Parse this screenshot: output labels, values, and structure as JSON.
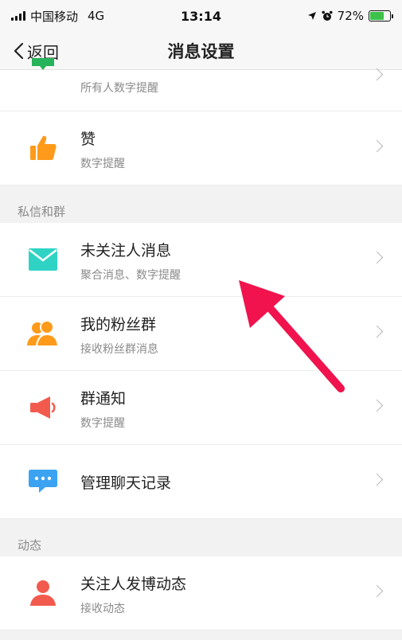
{
  "status_bar": {
    "carrier": "中国移动",
    "network": "4G",
    "time": "13:14",
    "battery_percent": "72%",
    "battery_level": 0.72
  },
  "nav": {
    "back_label": "返回",
    "title": "消息设置"
  },
  "top_partial_item": {
    "subtitle": "所有人数字提醒",
    "icon": "message-icon"
  },
  "like_item": {
    "title": "赞",
    "subtitle": "数字提醒",
    "icon": "thumbs-up-icon"
  },
  "section_private": {
    "title": "私信和群",
    "items": [
      {
        "title": "未关注人消息",
        "subtitle": "聚合消息、数字提醒",
        "icon": "envelope-icon"
      },
      {
        "title": "我的粉丝群",
        "subtitle": "接收粉丝群消息",
        "icon": "fan-group-icon"
      },
      {
        "title": "群通知",
        "subtitle": "数字提醒",
        "icon": "megaphone-icon"
      },
      {
        "title": "管理聊天记录",
        "subtitle": "",
        "icon": "chat-bubble-icon"
      }
    ]
  },
  "section_feed": {
    "title": "动态",
    "items": [
      {
        "title": "关注人发博动态",
        "subtitle": "接收动态",
        "icon": "person-icon"
      }
    ]
  },
  "colors": {
    "green": "#26b35a",
    "orange": "#ff9a1a",
    "teal": "#2fd3c4",
    "red": "#f25a4e",
    "blue": "#3ba3f2",
    "arrow": "#f0134d"
  }
}
